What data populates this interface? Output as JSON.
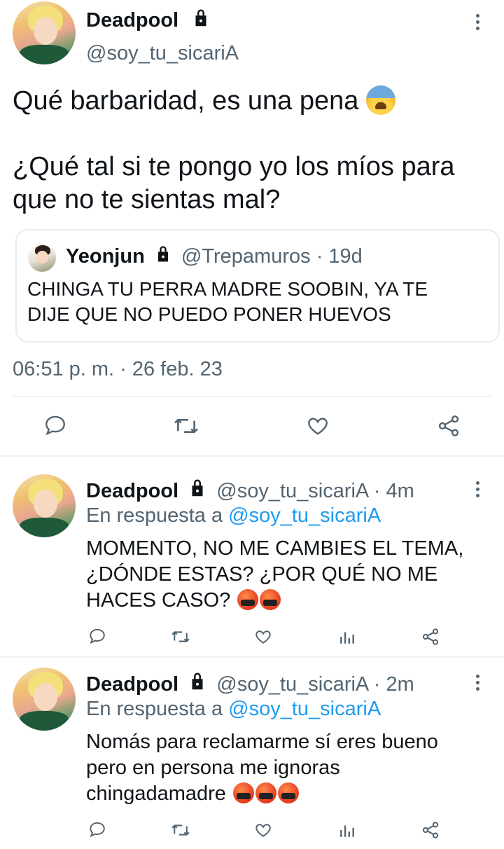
{
  "main_tweet": {
    "display_name": "Deadpool",
    "handle": "@soy_tu_sicariA",
    "text_line1": "Qué barbaridad, es una pena",
    "text_line2": "¿Qué tal si te pongo yo los míos para",
    "text_line3": "que no te sientas mal?",
    "emoji": "anxious-face-with-sweat",
    "quoted": {
      "display_name": "Yeonjun",
      "handle": "@Trepamuros",
      "time": "· 19d",
      "text_line1": "CHINGA TU PERRA MADRE SOOBIN, YA TE",
      "text_line2": "DIJE QUE NO PUEDO PONER HUEVOS"
    },
    "timestamp": "06:51 p. m. · 26 feb. 23",
    "actions": [
      "reply-icon",
      "retweet-icon",
      "like-icon",
      "share-icon"
    ]
  },
  "replies": [
    {
      "display_name": "Deadpool",
      "handle": "@soy_tu_sicariA",
      "time": "· 4m",
      "reply_prefix": "En respuesta a",
      "reply_to": "@soy_tu_sicariA",
      "lines": [
        "MOMENTO, NO ME CAMBIES EL TEMA,",
        "¿DÓNDE ESTAS? ¿POR QUÉ NO ME",
        "HACES CASO?"
      ],
      "emojis": [
        "face-with-symbols-on-mouth",
        "face-with-symbols-on-mouth"
      ]
    },
    {
      "display_name": "Deadpool",
      "handle": "@soy_tu_sicariA",
      "time": "· 2m",
      "reply_prefix": "En respuesta a",
      "reply_to": "@soy_tu_sicariA",
      "lines": [
        "Nomás para reclamarme sí eres bueno",
        "pero en persona me ignoras",
        "chingadamadre"
      ],
      "emojis": [
        "face-with-symbols-on-mouth",
        "face-with-symbols-on-mouth",
        "face-with-symbols-on-mouth"
      ]
    }
  ],
  "colors": {
    "text": "#0f1419",
    "secondary": "#536471",
    "link": "#1d9bf0",
    "divider": "#eff3f4"
  }
}
